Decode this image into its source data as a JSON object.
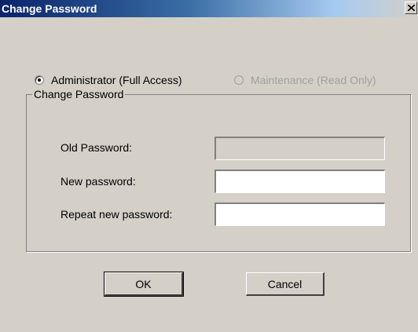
{
  "window": {
    "title": "Change Password",
    "close_icon": "close-icon"
  },
  "access": {
    "options": [
      {
        "label": "Administrator (Full Access)",
        "selected": true,
        "enabled": true
      },
      {
        "label": "Maintenance (Read Only)",
        "selected": false,
        "enabled": false
      }
    ]
  },
  "group": {
    "legend": "Change Password",
    "fields": [
      {
        "label": "Old Password:",
        "value": "",
        "enabled": false
      },
      {
        "label": "New password:",
        "value": "",
        "enabled": true
      },
      {
        "label": "Repeat new password:",
        "value": "",
        "enabled": true
      }
    ]
  },
  "buttons": {
    "ok": "OK",
    "cancel": "Cancel"
  },
  "colors": {
    "face": "#d4d0c8",
    "title_start": "#0a246a",
    "disabled_text": "#a0a0a0"
  }
}
